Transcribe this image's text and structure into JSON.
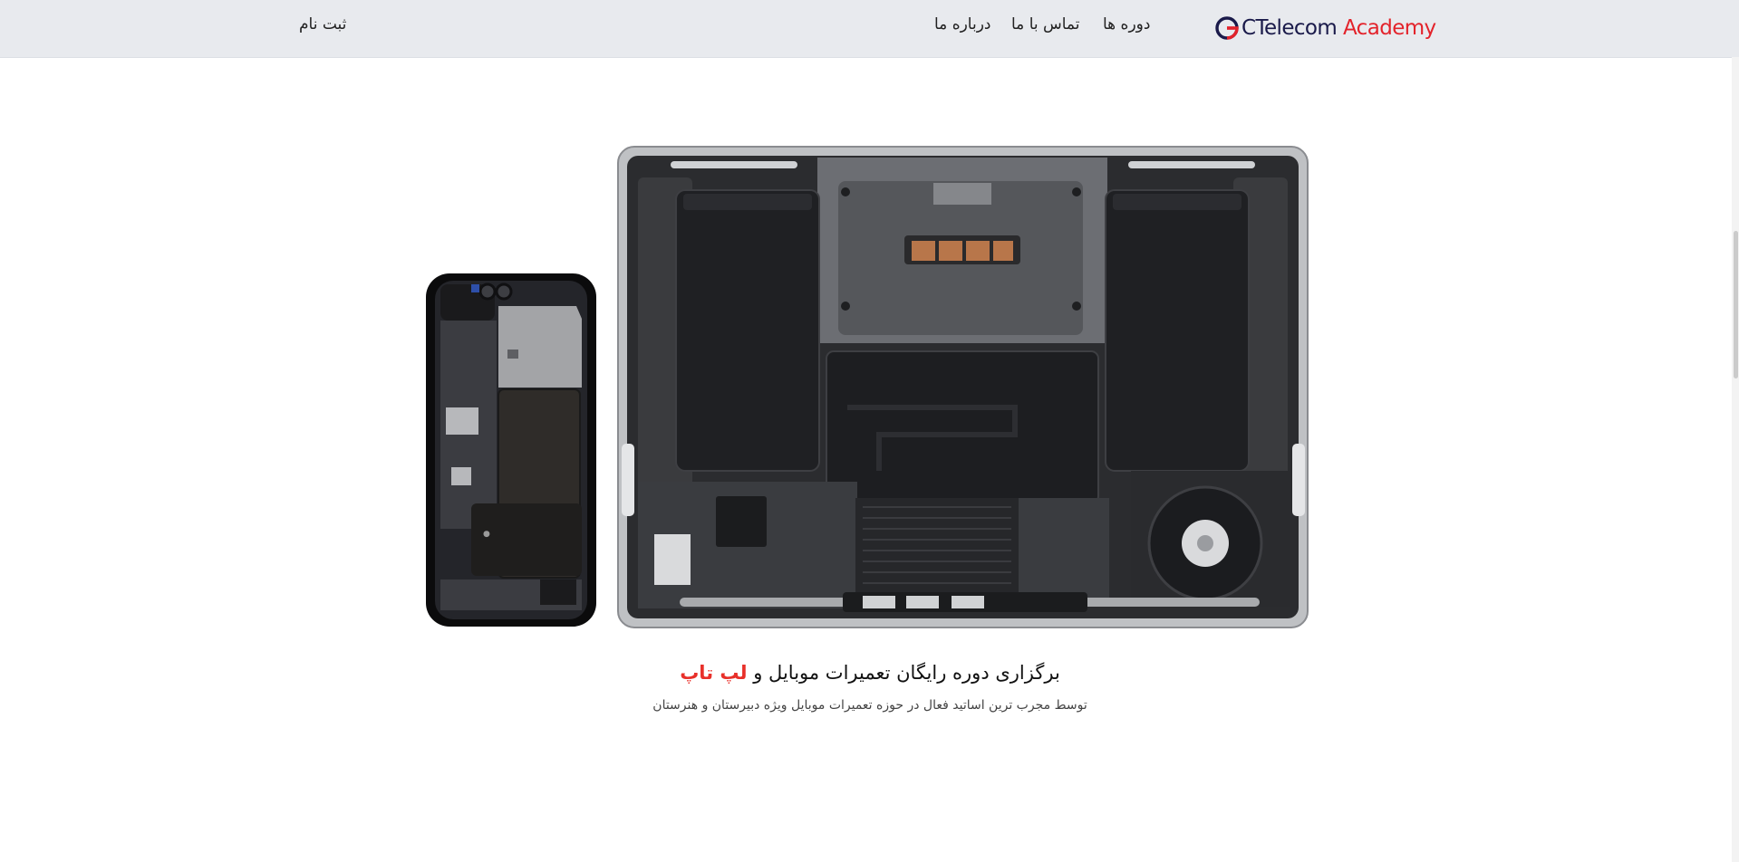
{
  "header": {
    "brand": {
      "name": "CTelecom",
      "accent": "Academy"
    },
    "nav": {
      "courses": "دوره ها",
      "contact": "تماس با ما",
      "about": "درباره ما"
    },
    "register": "ثبت نام"
  },
  "hero": {
    "title_main": "برگزاری دوره رایگان تعمیرات موبایل",
    "title_joiner": "و",
    "title_highlight": "لپ تاپ",
    "subtitle": "توسط مجرب ترین اساتید فعال در حوزه تعمیرات موبایل ویژه دبیرستان و هنرستان"
  },
  "colors": {
    "header_bg": "#e8eaee",
    "brand_dark": "#1a1a4a",
    "accent_red": "#e3232b",
    "highlight_red": "#e8302a"
  },
  "icons": [
    "ctelecom-logo-icon"
  ]
}
